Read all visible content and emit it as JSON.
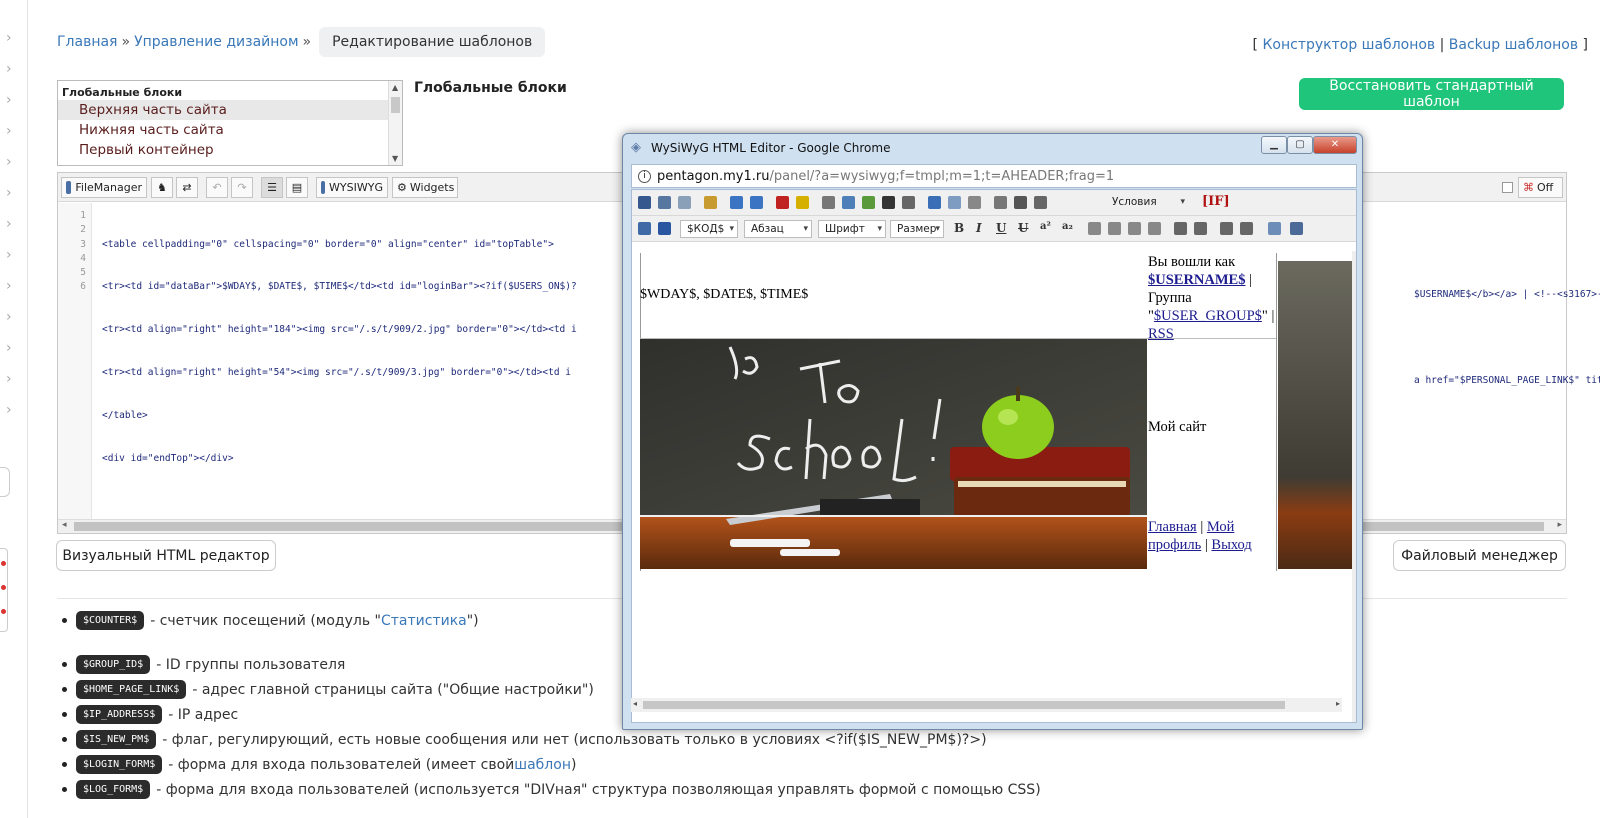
{
  "breadcrumb": {
    "items": [
      "Главная",
      "Управление дизайном"
    ],
    "separator": "»",
    "current": "Редактирование шаблонов"
  },
  "top_links": {
    "open": "[",
    "link1": "Конструктор шаблонов",
    "divider": "|",
    "link2": "Backup шаблонов",
    "close": "]"
  },
  "block_list": {
    "group": "Глобальные блоки",
    "options": [
      "Верхняя часть сайта",
      "Нижняя часть сайта",
      "Первый контейнер"
    ]
  },
  "section_title": "Глобальные блоки",
  "restore_button": "Восстановить стандартный шаблон",
  "editor": {
    "toolbar": {
      "filemanager": "FileManager",
      "wysiwyg": "WYSIWYG",
      "widgets": "Widgets",
      "off": "Off"
    },
    "line_numbers": [
      "1",
      "2",
      "3",
      "4",
      "5",
      "6"
    ],
    "code_lines": [
      "<table cellpadding=\"0\" cellspacing=\"0\" border=\"0\" align=\"center\" id=\"topTable\">",
      "<tr><td id=\"dataBar\">$WDAY$, $DATE$, $TIME$</td><td id=\"loginBar\"><?if($USERS_ON$)?",
      "<tr><td align=\"right\" height=\"184\"><img src=\"/.s/t/909/2.jpg\" border=\"0\"></td><td i",
      "<tr><td align=\"right\" height=\"54\"><img src=\"/.s/t/909/3.jpg\" border=\"0\"></td><td i",
      "</table>",
      "<div id=\"endTop\"></div>"
    ],
    "code_right_lines": [
      "$USERNAME$</b></a> | <!--<s3167>-",
      "a href=\"$PERSONAL_PAGE_LINK$\" tit"
    ]
  },
  "visual_button": "Визуальный HTML редактор",
  "file_manager_button": "Файловый менеджер",
  "variables": [
    {
      "tag": "$COUNTER$",
      "text": "- счетчик посещений (модуль \"",
      "link": "Статистика",
      "tail": "\")"
    },
    {
      "tag": "$GROUP_ID$",
      "text": "- ID группы пользователя",
      "link": "",
      "tail": ""
    },
    {
      "tag": "$HOME_PAGE_LINK$",
      "text": "- адрес главной страницы сайта (\"Общие настройки\")",
      "link": "",
      "tail": ""
    },
    {
      "tag": "$IP_ADDRESS$",
      "text": "- IP адрес",
      "link": "",
      "tail": ""
    },
    {
      "tag": "$IS_NEW_PM$",
      "text": "- флаг, регулирующий, есть новые сообщения или нет (использовать только в условиях <?if($IS_NEW_PM$)?>)",
      "link": "",
      "tail": ""
    },
    {
      "tag": "$LOGIN_FORM$",
      "text": "- форма для входа пользователей (имеет свой ",
      "link": "шаблон",
      "tail": ")"
    },
    {
      "tag": "$LOG_FORM$",
      "text": "- форма для входа пользователей (используется \"DIVная\" структура позволяющая управлять формой с помощью CSS)",
      "link": "",
      "tail": ""
    }
  ],
  "popup": {
    "title": "WySiWyG HTML Editor - Google Chrome",
    "url_host": "pentagon.my1.ru",
    "url_path": "/panel/?a=wysiwyg;f=tmpl;m=1;t=AHEADER;frag=1",
    "toolbar": {
      "conditions": "Условия",
      "if": "[IF]",
      "kod": "$КОД$",
      "paragraph": "Абзац",
      "font": "Шрифт",
      "size": "Размер"
    },
    "content": {
      "date": "$WDAY$, $DATE$, $TIME$",
      "login_prefix": "Вы вошли как",
      "username": "$USERNAME$",
      "group_prefix": "Группа \"",
      "group": "$USER_GROUP$",
      "group_suffix": "\"",
      "rss": "RSS",
      "site_name": "Мой сайт",
      "nav_home": "Главная",
      "nav_profile": "Мой профиль",
      "nav_logout": "Выход"
    }
  },
  "colors": {
    "link": "#3a78b8",
    "restore_button": "#1ec57a",
    "code_text": "#1f2a7a",
    "tag_bg": "#2b2b2b"
  }
}
